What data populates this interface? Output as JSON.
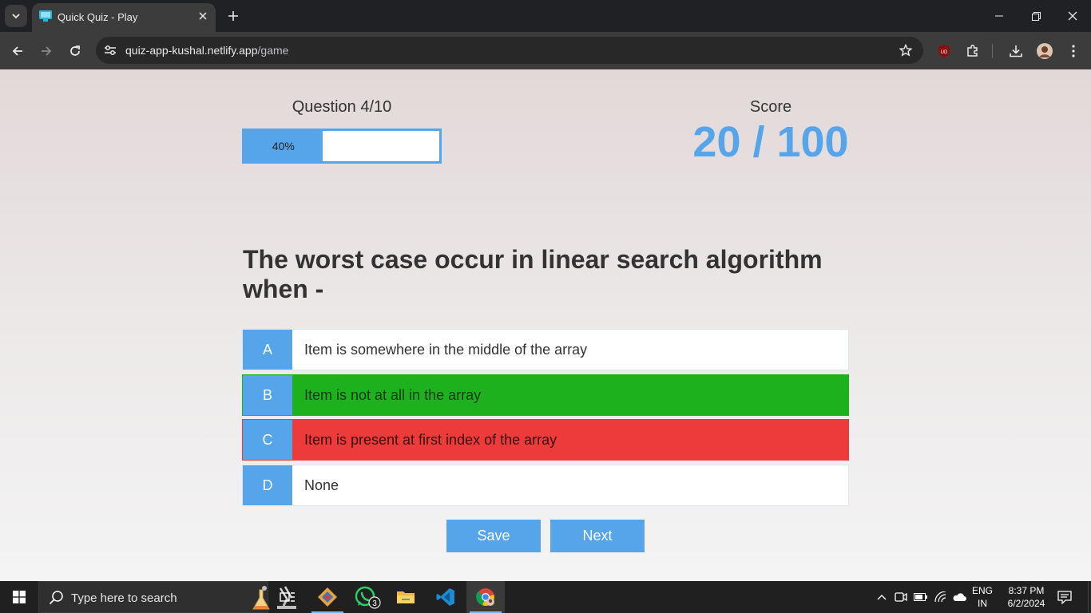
{
  "browser": {
    "tab_title": "Quick Quiz - Play",
    "url_host": "quiz-app-kushal.netlify.app",
    "url_path": "/game",
    "ublock_badge": "UD"
  },
  "quiz": {
    "question_counter": "Question 4/10",
    "progress_percent": 40,
    "progress_label": "40%",
    "score_label": "Score",
    "score_value": "20 / 100",
    "question": "The worst case occur in linear search algorithm when -",
    "choices": [
      {
        "prefix": "A",
        "text": "Item is somewhere in the middle of the array",
        "state": "default"
      },
      {
        "prefix": "B",
        "text": "Item is not at all in the array",
        "state": "correct"
      },
      {
        "prefix": "C",
        "text": "Item is present at first index of the array",
        "state": "incorrect"
      },
      {
        "prefix": "D",
        "text": "None",
        "state": "default"
      }
    ],
    "save_label": "Save",
    "next_label": "Next",
    "colors": {
      "accent": "#56a5eb",
      "correct": "#1eb11e",
      "incorrect": "#ed3a3a"
    }
  },
  "taskbar": {
    "search_placeholder": "Type here to search",
    "whatsapp_badge": "3",
    "lang_top": "ENG",
    "lang_bottom": "IN",
    "time": "8:37 PM",
    "date": "6/2/2024"
  }
}
